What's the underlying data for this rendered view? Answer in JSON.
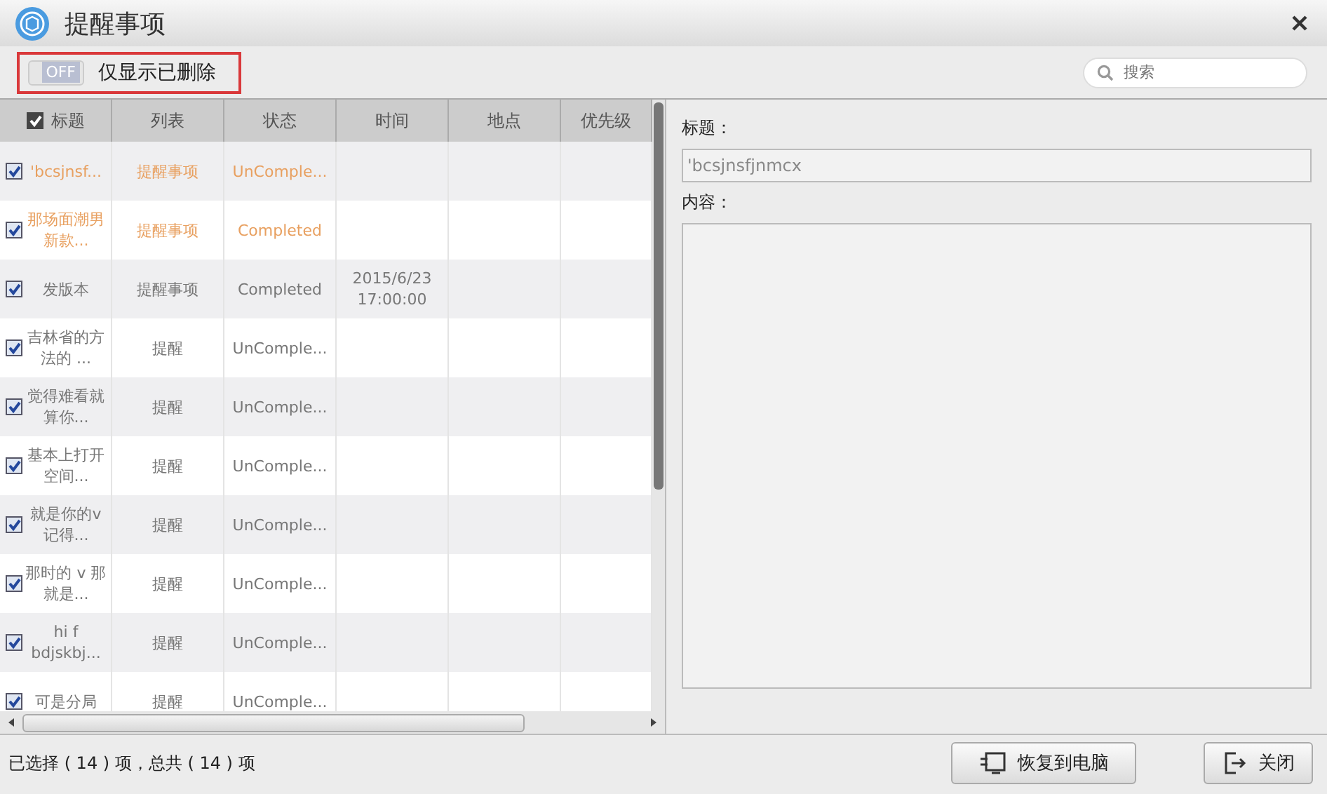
{
  "window": {
    "title": "提醒事项"
  },
  "toolbar": {
    "toggle": {
      "label": "OFF",
      "on": false
    },
    "filter_label": "仅显示已删除",
    "search": {
      "placeholder": "搜索"
    }
  },
  "table": {
    "select_all": true,
    "columns": [
      "标题",
      "列表",
      "状态",
      "时间",
      "地点",
      "优先级"
    ],
    "rows": [
      {
        "checked": true,
        "highlighted": true,
        "title": "'bcsjnsf...",
        "list": "提醒事项",
        "status": "UnComple...",
        "time": ""
      },
      {
        "checked": true,
        "highlighted": true,
        "title": "那场面潮男新款...",
        "list": "提醒事项",
        "status": "Completed",
        "time": ""
      },
      {
        "checked": true,
        "highlighted": false,
        "title": "发版本",
        "list": "提醒事项",
        "status": "Completed",
        "time": "2015/6/23 17:00:00"
      },
      {
        "checked": true,
        "highlighted": false,
        "title": "吉林省的方法的 ...",
        "list": "提醒",
        "status": "UnComple...",
        "time": ""
      },
      {
        "checked": true,
        "highlighted": false,
        "title": "觉得难看就算你...",
        "list": "提醒",
        "status": "UnComple...",
        "time": ""
      },
      {
        "checked": true,
        "highlighted": false,
        "title": "基本上打开空间...",
        "list": "提醒",
        "status": "UnComple...",
        "time": ""
      },
      {
        "checked": true,
        "highlighted": false,
        "title": "就是你的v 记得...",
        "list": "提醒",
        "status": "UnComple...",
        "time": ""
      },
      {
        "checked": true,
        "highlighted": false,
        "title": "那时的 v 那就是...",
        "list": "提醒",
        "status": "UnComple...",
        "time": ""
      },
      {
        "checked": true,
        "highlighted": false,
        "title": "hi f bdjskbj...",
        "list": "提醒",
        "status": "UnComple...",
        "time": ""
      },
      {
        "checked": true,
        "highlighted": false,
        "title": "可是分局",
        "list": "提醒",
        "status": "UnComple...",
        "time": ""
      }
    ]
  },
  "detail": {
    "title_label": "标题：",
    "title_value": "'bcsjnsfjnmcx",
    "content_label": "内容："
  },
  "status_bar": {
    "text": "已选择 ( 14 ) 项，总共 ( 14 ) 项"
  },
  "buttons": [
    {
      "kind": "restore",
      "label": "恢复到电脑"
    },
    {
      "kind": "close",
      "label": "关闭"
    }
  ]
}
